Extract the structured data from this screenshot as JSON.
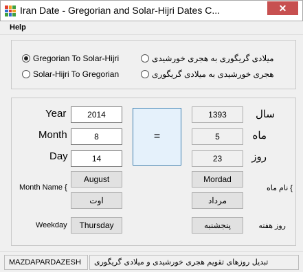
{
  "window": {
    "title": "Iran Date - Gregorian and Solar-Hijri Dates C...",
    "close_label": "✕",
    "icon_colors": [
      "#e04030",
      "#f0a020",
      "#40a040",
      "#3070d0",
      "#e04030",
      "#f0a020",
      "#40a040",
      "#3070d0",
      "#40a040"
    ]
  },
  "menu": {
    "help": "Help"
  },
  "conversion": {
    "greg_to_solar": "Gregorian To Solar-Hijri",
    "solar_to_greg": "Solar-Hijri To Gregorian",
    "greg_to_solar_fa": "میلادی گریگوری به هجری خورشیدی",
    "solar_to_greg_fa": "هجری خورشیدی به میلادی گریگوری",
    "selected": "greg_to_solar"
  },
  "gregorian": {
    "year_label": "Year",
    "year": "2014",
    "month_label": "Month",
    "month": "8",
    "day_label": "Day",
    "day": "14",
    "month_name_label": "Month Name {",
    "month_name": "August",
    "month_name_fa": "اوت",
    "weekday_label": "Weekday",
    "weekday": "Thursday"
  },
  "equals_label": "=",
  "solar": {
    "year_label": "سال",
    "year": "1393",
    "month_label": "ماه",
    "month": "5",
    "day_label": "روز",
    "day": "23",
    "month_name_label": "} نام ماه",
    "month_name": "Mordad",
    "month_name_fa": "مرداد",
    "weekday_label": "روز هفته",
    "weekday": "پنجشنبه"
  },
  "status": {
    "left": "MAZDAPARDAZESH",
    "right": "تبدیل روزهای تقویم هجری خورشیدی و میلادی گریگوری"
  }
}
